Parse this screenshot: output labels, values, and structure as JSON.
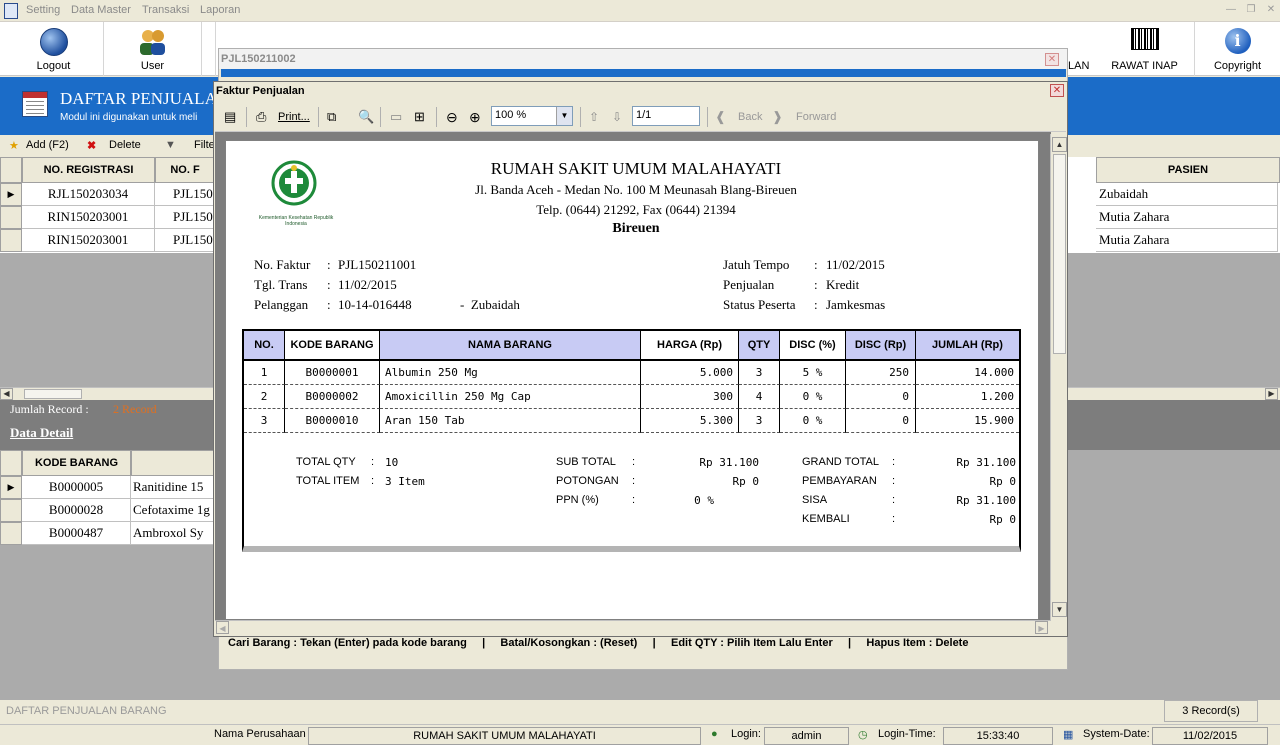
{
  "menubar": {
    "items": [
      "Setting",
      "Data Master",
      "Transaksi",
      "Laporan"
    ]
  },
  "toolbar": {
    "buttons": [
      {
        "label": "Logout",
        "icon": "logout-globe-icon"
      },
      {
        "label": "User",
        "icon": "user-icon"
      },
      {
        "label": "",
        "icon": "lock-icon"
      },
      {
        "label": "",
        "icon": "user-icon"
      },
      {
        "label": "",
        "icon": "person-icon"
      },
      {
        "label": "",
        "icon": "users-icon"
      },
      {
        "label": "",
        "icon": "users-icon"
      },
      {
        "label": "",
        "icon": "barcode-icon"
      },
      {
        "label": "",
        "icon": "barcode-icon"
      },
      {
        "label": "",
        "icon": "barcode-icon"
      },
      {
        "label": "LAN",
        "icon": "barcode-icon"
      },
      {
        "label": "RAWAT INAP",
        "icon": "barcode-icon"
      },
      {
        "label": "Copyright",
        "icon": "info-icon"
      }
    ]
  },
  "header": {
    "title": "DAFTAR PENJUALA",
    "subtitle": "Modul ini digunakan untuk meli"
  },
  "actions": {
    "add": "Add (F2)",
    "delete": "Delete",
    "filter": "Filte"
  },
  "main_grid": {
    "columns": [
      "NO. REGISTRASI",
      "NO. F",
      "PASIEN"
    ],
    "rows": [
      {
        "reg": "RJL150203034",
        "nof": "PJL150",
        "pasien": "Zubaidah"
      },
      {
        "reg": "RIN150203001",
        "nof": "PJL150",
        "pasien": "Mutia Zahara"
      },
      {
        "reg": "RIN150203001",
        "nof": "PJL150",
        "pasien": "Mutia Zahara"
      }
    ]
  },
  "record": {
    "label": "Jumlah Record :",
    "value": "2 Record",
    "detail_link": "Data Detail"
  },
  "detail_grid": {
    "columns": [
      "KODE BARANG"
    ],
    "rows": [
      {
        "kode": "B0000005",
        "nama": "Ranitidine 15"
      },
      {
        "kode": "B0000028",
        "nama": "Cefotaxime 1g"
      },
      {
        "kode": "B0000487",
        "nama": "Ambroxol Sy"
      }
    ]
  },
  "bg_dialog": {
    "title": "PJL150211002",
    "hint": "Cari Barang : Tekan (Enter) pada kode barang     |     Batal/Kosongkan : (Reset)     |     Edit QTY : Pilih Item Lalu Enter     |     Hapus Item : Delete"
  },
  "report": {
    "window_title": "Faktur Penjualan",
    "toolbar": {
      "print": "Print...",
      "zoom": "100 %",
      "page": "1/1",
      "back": "Back",
      "forward": "Forward"
    },
    "hospital": "RUMAH SAKIT UMUM MALAHAYATI",
    "address": "Jl. Banda Aceh - Medan No. 100 M Meunasah Blang-Bireuen",
    "phone": "Telp. (0644) 21292, Fax (0644) 21394",
    "city": "Bireuen",
    "logo_text": "Kementerian Kesehatan Republik Indonesia",
    "left_info": [
      {
        "label": "No. Faktur",
        "value": "PJL150211001"
      },
      {
        "label": "Tgl. Trans",
        "value": "11/02/2015"
      },
      {
        "label": "Pelanggan",
        "value": "10-14-016448",
        "extra": "-  Zubaidah"
      }
    ],
    "right_info": [
      {
        "label": "Jatuh Tempo",
        "value": "11/02/2015"
      },
      {
        "label": "Penjualan",
        "value": "Kredit"
      },
      {
        "label": "Status Peserta",
        "value": "Jamkesmas"
      }
    ],
    "columns": [
      "NO.",
      "KODE BARANG",
      "NAMA BARANG",
      "HARGA (Rp)",
      "QTY",
      "DISC (%)",
      "DISC (Rp)",
      "JUMLAH (Rp)"
    ],
    "items": [
      {
        "no": "1",
        "kode": "B0000001",
        "nama": "Albumin 250 Mg",
        "harga": "5.000",
        "qty": "3",
        "discp": "5 %",
        "discr": "250",
        "jumlah": "14.000"
      },
      {
        "no": "2",
        "kode": "B0000002",
        "nama": "Amoxicillin 250 Mg Cap",
        "harga": "300",
        "qty": "4",
        "discp": "0 %",
        "discr": "0",
        "jumlah": "1.200"
      },
      {
        "no": "3",
        "kode": "B0000010",
        "nama": "Aran 150 Tab",
        "harga": "5.300",
        "qty": "3",
        "discp": "0 %",
        "discr": "0",
        "jumlah": "15.900"
      }
    ],
    "summary": {
      "total_qty_label": "TOTAL QTY",
      "total_qty": "10",
      "total_item_label": "TOTAL ITEM",
      "total_item": "3 Item",
      "subtotal_label": "SUB TOTAL",
      "subtotal": "Rp 31.100",
      "potongan_label": "POTONGAN",
      "potongan": "Rp 0",
      "ppn_label": "PPN (%)",
      "ppn": "0 %",
      "grand_label": "GRAND TOTAL",
      "grand": "Rp 31.100",
      "bayar_label": "PEMBAYARAN",
      "bayar": "Rp 0",
      "sisa_label": "SISA",
      "sisa": "Rp 31.100",
      "kembali_label": "KEMBALI",
      "kembali": "Rp 0"
    }
  },
  "footer": {
    "module": "DAFTAR PENJUALAN BARANG",
    "records": "3 Record(s)"
  },
  "status": {
    "company_label": "Nama Perusahaan",
    "company": "RUMAH SAKIT UMUM MALAHAYATI",
    "login_label": "Login:",
    "login": "admin",
    "time_label": "Login-Time:",
    "time": "15:33:40",
    "date_label": "System-Date:",
    "date": "11/02/2015"
  },
  "colors": {
    "header_blue": "#1b6cc8",
    "record_value": "#e07020",
    "table_header": "#c8cbf4"
  }
}
